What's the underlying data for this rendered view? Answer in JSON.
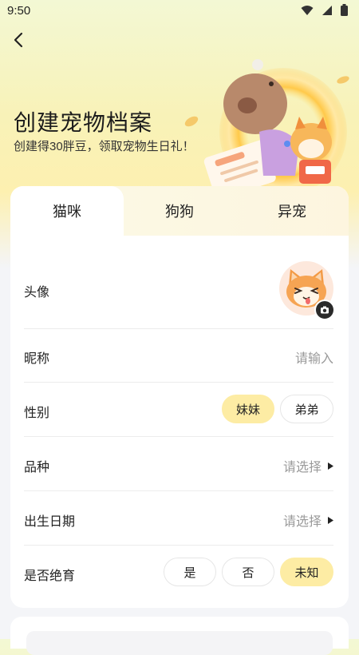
{
  "status_bar": {
    "time": "9:50"
  },
  "header": {
    "title": "创建宠物档案",
    "subtitle": "创建得30胖豆，领取宠物生日礼！"
  },
  "tabs": [
    {
      "label": "猫咪",
      "active": true
    },
    {
      "label": "狗狗",
      "active": false
    },
    {
      "label": "异宠",
      "active": false
    }
  ],
  "form": {
    "avatar_label": "头像",
    "nickname_label": "昵称",
    "nickname_placeholder": "请输入",
    "gender_label": "性别",
    "gender_options": [
      "妹妹",
      "弟弟"
    ],
    "gender_selected": "妹妹",
    "breed_label": "品种",
    "breed_placeholder": "请选择",
    "birthday_label": "出生日期",
    "birthday_placeholder": "请选择",
    "neutered_label": "是否绝育",
    "neutered_options": [
      "是",
      "否",
      "未知"
    ],
    "neutered_selected": "未知"
  },
  "colors": {
    "accent": "#fdeca4",
    "background_top": "#f8f2b8",
    "text": "#222222",
    "placeholder": "#9a9a9a"
  }
}
